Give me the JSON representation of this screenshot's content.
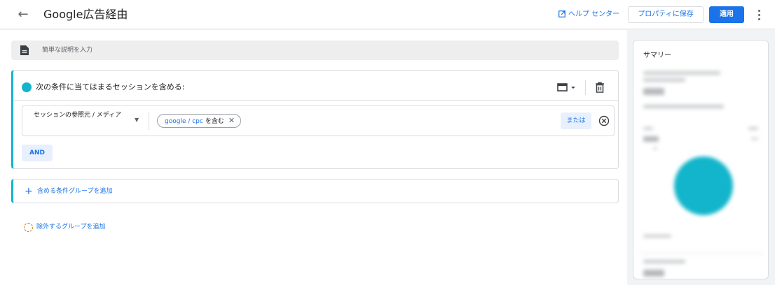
{
  "header": {
    "back_icon": "arrow-left-icon",
    "title": "Google広告経由",
    "help_label": "ヘルプ センター",
    "help_icon": "open-in-new-icon",
    "save_label": "プロパティに保存",
    "apply_label": "適用",
    "more_icon": "more-vert-icon"
  },
  "description": {
    "placeholder": "簡単な説明を入力",
    "icon": "document-icon"
  },
  "include_group": {
    "title": "次の条件に当てはまるセッションを含める:",
    "accent_color": "#12b5cb",
    "layout_icon": "layout-dropdown-icon",
    "delete_icon": "trash-icon",
    "condition": {
      "dimension": "セッションの参照元 / メディア",
      "value": "google / cpc",
      "operator": "を含む",
      "or_label": "または"
    },
    "and_label": "AND"
  },
  "add_include_group_label": "含める条件グループを追加",
  "add_exclude_group_label": "除外するグループを追加",
  "summary": {
    "title": "サマリー",
    "donut_color": "#12b5cb"
  },
  "colors": {
    "primary": "#1a73e8",
    "accent": "#12b5cb",
    "exclude": "#e37400"
  }
}
